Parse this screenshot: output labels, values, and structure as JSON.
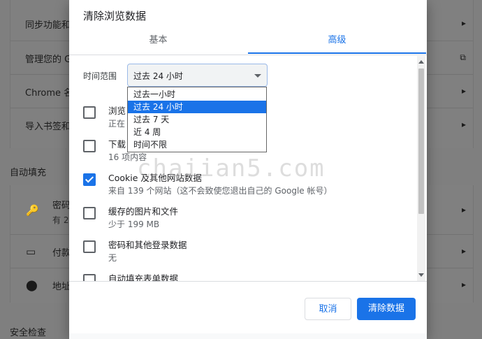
{
  "background": {
    "rows_top": [
      {
        "label": "同步功能和",
        "icon": "",
        "arrow": "▸"
      },
      {
        "label": "管理您的 G",
        "icon": "",
        "arrow": "⧉"
      },
      {
        "label": "Chrome 名",
        "icon": "",
        "arrow": "▸"
      },
      {
        "label": "导入书签和",
        "icon": "",
        "arrow": "▸"
      }
    ],
    "section_autofill": "自动填充",
    "rows_autofill": [
      {
        "label": "密码",
        "sub": "有 2",
        "icon": "🔑",
        "arrow": "▸"
      },
      {
        "label": "付款",
        "sub": "",
        "icon": "▭",
        "arrow": "▸"
      },
      {
        "label": "地址",
        "sub": "",
        "icon": "⬤",
        "arrow": "▸"
      }
    ],
    "section_safety": "安全检查"
  },
  "dialog": {
    "title": "清除浏览数据",
    "tabs": [
      {
        "label": "基本",
        "active": false
      },
      {
        "label": "高级",
        "active": true
      }
    ],
    "time_range_label": "时间范围",
    "time_range_value": "过去 24 小时",
    "time_range_options": [
      "过去一小时",
      "过去 24 小时",
      "过去 7 天",
      "近 4 周",
      "时间不限"
    ],
    "items": [
      {
        "title": "浏览",
        "desc": "正在",
        "checked": false
      },
      {
        "title": "下载",
        "desc": "16 项内容",
        "checked": false
      },
      {
        "title": "Cookie 及其他网站数据",
        "desc": "来自 139 个网站（这不会致使您退出自己的 Google 帐号）",
        "checked": true
      },
      {
        "title": "缓存的图片和文件",
        "desc": "少于 199 MB",
        "checked": false
      },
      {
        "title": "密码和其他登录数据",
        "desc": "无",
        "checked": false
      },
      {
        "title": "自动填充表单数据",
        "desc": "",
        "checked": false
      }
    ],
    "cancel_label": "取消",
    "clear_label": "清除数据"
  },
  "watermark": "chaiian5.com",
  "colors": {
    "accent": "#1a73e8"
  }
}
